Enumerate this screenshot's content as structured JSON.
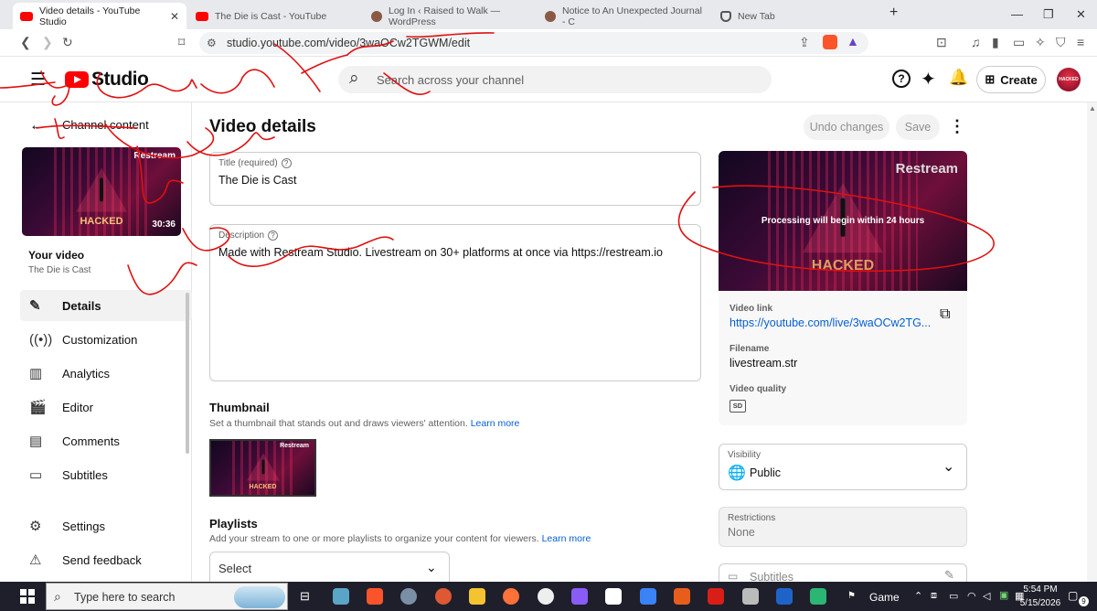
{
  "browser": {
    "tabs": [
      {
        "label": "Video details - YouTube Studio",
        "active": true,
        "favicon_color": "#ff0000"
      },
      {
        "label": "The Die is Cast - YouTube",
        "active": false,
        "favicon_color": "#ff0000"
      },
      {
        "label": "Log In ‹ Raised to Walk — WordPress",
        "active": false,
        "favicon_color": "#8a5a44"
      },
      {
        "label": "Notice to An Unexpected Journal - C",
        "active": false,
        "favicon_color": "#8a5a44"
      },
      {
        "label": "New Tab",
        "active": false,
        "favicon_color": "#555555"
      }
    ],
    "url": "studio.youtube.com/video/3waOCw2TGWM/edit"
  },
  "header": {
    "logo_text": "Studio",
    "search_placeholder": "Search across your channel",
    "create_label": "Create",
    "avatar_text": "HACKED"
  },
  "sidebar": {
    "back_label": "Channel content",
    "thumb_brand": "Restream",
    "thumb_hacked": "HACKED",
    "thumb_duration": "30:36",
    "your_video_label": "Your video",
    "video_title": "The Die is Cast",
    "items": [
      {
        "label": "Details",
        "icon": "pencil-icon",
        "active": true
      },
      {
        "label": "Customization",
        "icon": "broadcast-icon",
        "active": false
      },
      {
        "label": "Analytics",
        "icon": "analytics-icon",
        "active": false
      },
      {
        "label": "Editor",
        "icon": "editor-icon",
        "active": false
      },
      {
        "label": "Comments",
        "icon": "comments-icon",
        "active": false
      },
      {
        "label": "Subtitles",
        "icon": "subtitles-icon",
        "active": false
      }
    ],
    "footer_items": [
      {
        "label": "Settings",
        "icon": "gear-icon"
      },
      {
        "label": "Send feedback",
        "icon": "feedback-icon"
      }
    ]
  },
  "main": {
    "page_title": "Video details",
    "undo_label": "Undo changes",
    "save_label": "Save",
    "title_field": {
      "label": "Title (required)",
      "value": "The Die is Cast"
    },
    "description_field": {
      "label": "Description",
      "value": "Made with Restream Studio. Livestream on 30+ platforms at once via https://restream.io"
    },
    "thumbnail": {
      "heading": "Thumbnail",
      "subtext": "Set a thumbnail that stands out and draws viewers' attention.",
      "link": "Learn more"
    },
    "playlists": {
      "heading": "Playlists",
      "subtext": "Add your stream to one or more playlists to organize your content for viewers.",
      "link": "Learn more",
      "select_value": "Select"
    }
  },
  "right_panel": {
    "preview_brand": "Restream",
    "preview_hacked": "HACKED",
    "processing_text": "Processing will begin within 24 hours",
    "video_link_label": "Video link",
    "video_link": "https://youtube.com/live/3waOCw2TG...",
    "filename_label": "Filename",
    "filename": "livestream.str",
    "quality_label": "Video quality",
    "quality_badge": "SD",
    "visibility_label": "Visibility",
    "visibility_value": "Public",
    "restrictions_label": "Restrictions",
    "restrictions_value": "None",
    "subtitles_label": "Subtitles"
  },
  "taskbar": {
    "search_placeholder": "Type here to search",
    "game_label": "Game",
    "time": "5:54 PM",
    "date": "5/15/2026",
    "notifications": "9"
  },
  "colors": {
    "accent_blue": "#065fd4",
    "youtube_red": "#ff0000",
    "scribble_red": "#e01010"
  }
}
